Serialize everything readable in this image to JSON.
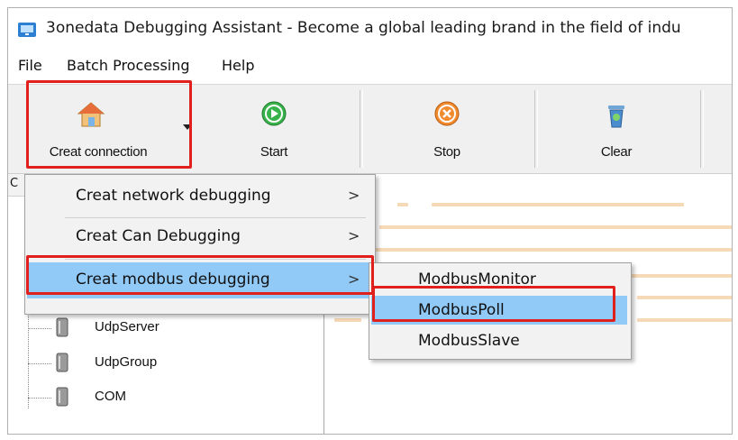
{
  "window": {
    "title": "3onedata Debugging Assistant - Become a global leading brand in the field of indu"
  },
  "menubar": {
    "items": [
      "File",
      "Batch Processing",
      "Help"
    ]
  },
  "toolbar": {
    "create_label": "Creat connection",
    "start_label": "Start",
    "stop_label": "Stop",
    "clear_label": "Clear"
  },
  "left_panel": {
    "header_char": "C",
    "tree": [
      {
        "label": "UdpServer",
        "icon": "server-icon"
      },
      {
        "label": "UdpGroup",
        "icon": "server-icon"
      },
      {
        "label": "COM",
        "icon": "server-icon"
      }
    ]
  },
  "dropdown": {
    "items": [
      {
        "label": "Creat network debugging",
        "arrow": ">"
      },
      {
        "label": "Creat Can Debugging",
        "arrow": ">"
      },
      {
        "label": "Creat modbus debugging",
        "arrow": ">",
        "highlighted": true
      }
    ]
  },
  "submenu": {
    "items": [
      {
        "label": "ModbusMonitor"
      },
      {
        "label": "ModbusPoll",
        "highlighted": true
      },
      {
        "label": "ModbusSlave"
      }
    ]
  },
  "colors": {
    "highlight": "#91c9f7",
    "annotation_red": "#e0201c",
    "log_line": "#f6d9b6"
  }
}
